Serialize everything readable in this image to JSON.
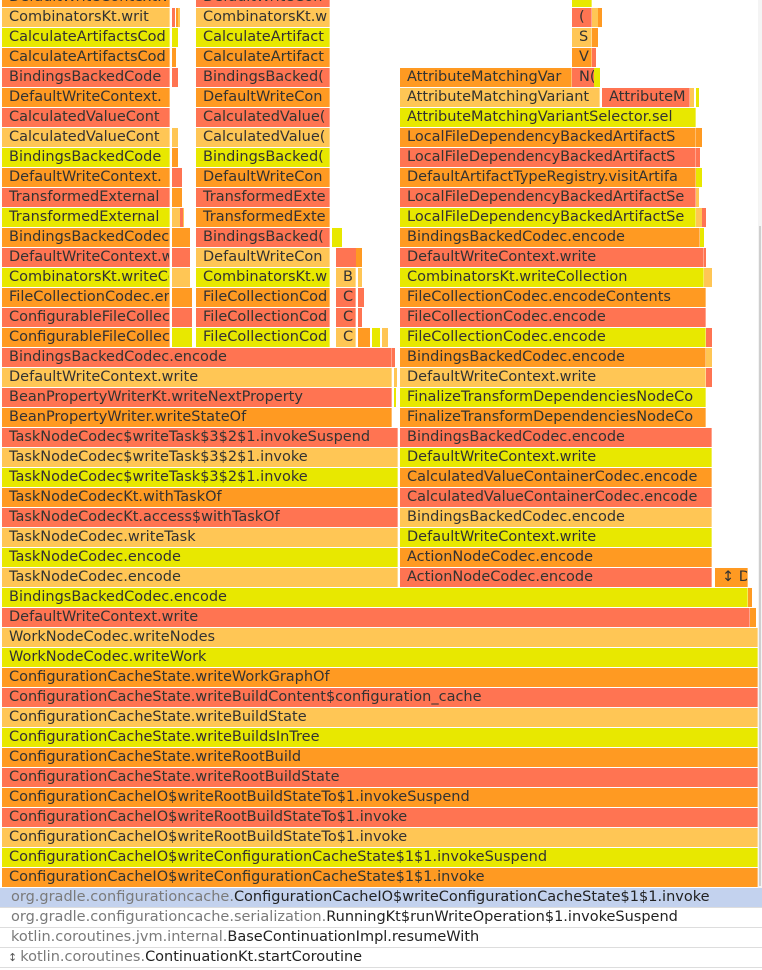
{
  "flame_graph": {
    "frames": [
      {
        "label": "DefaultWriteContext.write",
        "row": 0,
        "col": "L",
        "color": "orange"
      },
      {
        "label": "CombinatorsKt.writ",
        "row": 1,
        "col": "L",
        "color": "light"
      },
      {
        "label": "CalculateArtifactsCod",
        "row": 2,
        "col": "L",
        "color": "yellow"
      },
      {
        "label": "CalculateArtifactsCod",
        "row": 3,
        "col": "L",
        "color": "orange"
      },
      {
        "label": "BindingsBackedCode",
        "row": 4,
        "col": "L",
        "color": "red"
      },
      {
        "label": "DefaultWriteContext.",
        "row": 5,
        "col": "L",
        "color": "orange"
      },
      {
        "label": "CalculatedValueCont",
        "row": 6,
        "col": "L",
        "color": "red"
      },
      {
        "label": "CalculatedValueCont",
        "row": 7,
        "col": "L",
        "color": "light"
      },
      {
        "label": "BindingsBackedCode",
        "row": 8,
        "col": "L",
        "color": "yellow"
      },
      {
        "label": "DefaultWriteContext.",
        "row": 9,
        "col": "L",
        "color": "orange"
      },
      {
        "label": "TransformedExternal",
        "row": 10,
        "col": "L",
        "color": "red"
      },
      {
        "label": "TransformedExternal",
        "row": 11,
        "col": "L",
        "color": "yellow"
      },
      {
        "label": "BindingsBackedCodec.",
        "row": 12,
        "col": "L",
        "color": "orange"
      },
      {
        "label": "DefaultWriteContext.wi",
        "row": 13,
        "col": "L",
        "color": "red"
      },
      {
        "label": "CombinatorsKt.writeCo",
        "row": 14,
        "col": "L",
        "color": "yellow"
      },
      {
        "label": "FileCollectionCodec.enc",
        "row": 15,
        "col": "L",
        "color": "orange"
      },
      {
        "label": "ConfigurableFileCollecti",
        "row": 16,
        "col": "L",
        "color": "red"
      },
      {
        "label": "ConfigurableFileCollecti",
        "row": 17,
        "col": "L",
        "color": "orange"
      },
      {
        "label": "DefaultWriteCon",
        "row": 0,
        "col": "M",
        "color": "red"
      },
      {
        "label": "CombinatorsKt.w",
        "row": 1,
        "col": "M",
        "color": "light"
      },
      {
        "label": "CalculateArtifact",
        "row": 2,
        "col": "M",
        "color": "yellow"
      },
      {
        "label": "CalculateArtifact",
        "row": 3,
        "col": "M",
        "color": "orange"
      },
      {
        "label": "BindingsBacked(",
        "row": 4,
        "col": "M",
        "color": "red"
      },
      {
        "label": "DefaultWriteCon",
        "row": 5,
        "col": "M",
        "color": "orange"
      },
      {
        "label": "CalculatedValue(",
        "row": 6,
        "col": "M",
        "color": "red"
      },
      {
        "label": "CalculatedValue(",
        "row": 7,
        "col": "M",
        "color": "light"
      },
      {
        "label": "BindingsBacked(",
        "row": 8,
        "col": "M",
        "color": "yellow"
      },
      {
        "label": "DefaultWriteCon",
        "row": 9,
        "col": "M",
        "color": "orange"
      },
      {
        "label": "TransformedExte",
        "row": 10,
        "col": "M",
        "color": "red"
      },
      {
        "label": "TransformedExte",
        "row": 11,
        "col": "M",
        "color": "orange"
      },
      {
        "label": "BindingsBacked(",
        "row": 12,
        "col": "M",
        "color": "red"
      },
      {
        "label": "DefaultWriteCon",
        "row": 13,
        "col": "M",
        "color": "light"
      },
      {
        "label": "CombinatorsKt.w",
        "row": 14,
        "col": "M",
        "color": "yellow"
      },
      {
        "label": "FileCollectionCod",
        "row": 15,
        "col": "M",
        "color": "orange"
      },
      {
        "label": "FileCollectionCod",
        "row": 16,
        "col": "M",
        "color": "red"
      },
      {
        "label": "FileCollectionCod",
        "row": 17,
        "col": "M",
        "color": "yellow"
      },
      {
        "label": "B",
        "row": 14,
        "col": "S",
        "color": "light"
      },
      {
        "label": "C",
        "row": 15,
        "col": "S",
        "color": "red"
      },
      {
        "label": "C",
        "row": 16,
        "col": "S",
        "color": "red"
      },
      {
        "label": "C",
        "row": 17,
        "col": "S",
        "color": "light"
      },
      {
        "label": "",
        "row": 0,
        "col": "T",
        "color": "yellow"
      },
      {
        "label": "(",
        "row": 1,
        "col": "T",
        "color": "red"
      },
      {
        "label": "S",
        "row": 2,
        "col": "T",
        "color": "light"
      },
      {
        "label": "V",
        "row": 3,
        "col": "T",
        "color": "orange"
      },
      {
        "label": "N(",
        "row": 4,
        "col": "T2",
        "color": "red"
      },
      {
        "label": "AttributeMatchingVar",
        "row": 4,
        "col": "R1",
        "color": "orange"
      },
      {
        "label": "AttributeMatchingVariant",
        "row": 5,
        "col": "R2",
        "color": "light"
      },
      {
        "label": "AttributeM",
        "row": 5,
        "col": "R3",
        "color": "red"
      },
      {
        "label": "AttributeMatchingVariantSelector.sel",
        "row": 6,
        "col": "R",
        "color": "yellow"
      },
      {
        "label": "LocalFileDependencyBackedArtifactS",
        "row": 7,
        "col": "R",
        "color": "orange"
      },
      {
        "label": "LocalFileDependencyBackedArtifactS",
        "row": 8,
        "col": "R",
        "color": "red"
      },
      {
        "label": "DefaultArtifactTypeRegistry.visitArtifa",
        "row": 9,
        "col": "R",
        "color": "orange"
      },
      {
        "label": "LocalFileDependencyBackedArtifactSe",
        "row": 10,
        "col": "R",
        "color": "red"
      },
      {
        "label": "LocalFileDependencyBackedArtifactSe",
        "row": 11,
        "col": "R",
        "color": "yellow"
      },
      {
        "label": "BindingsBackedCodec.encode",
        "row": 12,
        "col": "R",
        "color": "orange"
      },
      {
        "label": "DefaultWriteContext.write",
        "row": 13,
        "col": "R",
        "color": "red"
      },
      {
        "label": "CombinatorsKt.writeCollection",
        "row": 14,
        "col": "R",
        "color": "yellow"
      },
      {
        "label": "FileCollectionCodec.encodeContents",
        "row": 15,
        "col": "R",
        "color": "orange"
      },
      {
        "label": "FileCollectionCodec.encode",
        "row": 16,
        "col": "R",
        "color": "red"
      },
      {
        "label": "FileCollectionCodec.encode",
        "row": 17,
        "col": "R",
        "color": "yellow"
      },
      {
        "label": "BindingsBackedCodec.encode",
        "row": 18,
        "col": "R",
        "color": "orange"
      },
      {
        "label": "DefaultWriteContext.write",
        "row": 19,
        "col": "R",
        "color": "light"
      },
      {
        "label": "FinalizeTransformDependenciesNodeCo",
        "row": 20,
        "col": "R",
        "color": "yellow"
      },
      {
        "label": "FinalizeTransformDependenciesNodeCo",
        "row": 21,
        "col": "R",
        "color": "orange"
      },
      {
        "label": "BindingsBackedCodec.encode",
        "row": 22,
        "col": "R",
        "color": "red"
      },
      {
        "label": "DefaultWriteContext.write",
        "row": 23,
        "col": "R",
        "color": "yellow"
      },
      {
        "label": "CalculatedValueContainerCodec.encode",
        "row": 24,
        "col": "R",
        "color": "orange"
      },
      {
        "label": "CalculatedValueContainerCodec.encode",
        "row": 25,
        "col": "R",
        "color": "red"
      },
      {
        "label": "BindingsBackedCodec.encode",
        "row": 26,
        "col": "R",
        "color": "light"
      },
      {
        "label": "DefaultWriteContext.write",
        "row": 27,
        "col": "R",
        "color": "yellow"
      },
      {
        "label": "ActionNodeCodec.encode",
        "row": 28,
        "col": "R",
        "color": "orange"
      },
      {
        "label": "ActionNodeCodec.encode",
        "row": 29,
        "col": "R",
        "color": "red"
      },
      {
        "label": "↕ D",
        "row": 29,
        "col": "X",
        "color": "orange"
      },
      {
        "label": "BindingsBackedCodec.encode",
        "row": 18,
        "col": "LW",
        "color": "red"
      },
      {
        "label": "DefaultWriteContext.write",
        "row": 19,
        "col": "LW",
        "color": "light"
      },
      {
        "label": "BeanPropertyWriterKt.writeNextProperty",
        "row": 20,
        "col": "LW",
        "color": "red"
      },
      {
        "label": "BeanPropertyWriter.writeStateOf",
        "row": 21,
        "col": "LW",
        "color": "orange"
      },
      {
        "label": "TaskNodeCodec$writeTask$3$2$1.invokeSuspend",
        "row": 22,
        "col": "LX",
        "color": "red"
      },
      {
        "label": "TaskNodeCodec$writeTask$3$2$1.invoke",
        "row": 23,
        "col": "LX",
        "color": "light"
      },
      {
        "label": "TaskNodeCodec$writeTask$3$2$1.invoke",
        "row": 24,
        "col": "LX",
        "color": "yellow"
      },
      {
        "label": "TaskNodeCodecKt.withTaskOf",
        "row": 25,
        "col": "LX",
        "color": "orange"
      },
      {
        "label": "TaskNodeCodecKt.access$withTaskOf",
        "row": 26,
        "col": "LX",
        "color": "red"
      },
      {
        "label": "TaskNodeCodec.writeTask",
        "row": 27,
        "col": "LX",
        "color": "light"
      },
      {
        "label": "TaskNodeCodec.encode",
        "row": 28,
        "col": "LX",
        "color": "yellow"
      },
      {
        "label": "TaskNodeCodec.encode",
        "row": 29,
        "col": "LX",
        "color": "light"
      },
      {
        "label": "BindingsBackedCodec.encode",
        "row": 30,
        "col": "F1",
        "color": "yellow"
      },
      {
        "label": "DefaultWriteContext.write",
        "row": 31,
        "col": "F2",
        "color": "red"
      },
      {
        "label": "WorkNodeCodec.writeNodes",
        "row": 32,
        "col": "F",
        "color": "light"
      },
      {
        "label": "WorkNodeCodec.writeWork",
        "row": 33,
        "col": "F",
        "color": "yellow"
      },
      {
        "label": "ConfigurationCacheState.writeWorkGraphOf",
        "row": 34,
        "col": "F",
        "color": "orange"
      },
      {
        "label": "ConfigurationCacheState.writeBuildContent$configuration_cache",
        "row": 35,
        "col": "F",
        "color": "red"
      },
      {
        "label": "ConfigurationCacheState.writeBuildState",
        "row": 36,
        "col": "F",
        "color": "light"
      },
      {
        "label": "ConfigurationCacheState.writeBuildsInTree",
        "row": 37,
        "col": "F",
        "color": "yellow"
      },
      {
        "label": "ConfigurationCacheState.writeRootBuild",
        "row": 38,
        "col": "F",
        "color": "orange"
      },
      {
        "label": "ConfigurationCacheState.writeRootBuildState",
        "row": 39,
        "col": "F",
        "color": "red"
      },
      {
        "label": "ConfigurationCacheIO$writeRootBuildStateTo$1.invokeSuspend",
        "row": 40,
        "col": "F",
        "color": "orange"
      },
      {
        "label": "ConfigurationCacheIO$writeRootBuildStateTo$1.invoke",
        "row": 41,
        "col": "F",
        "color": "red"
      },
      {
        "label": "ConfigurationCacheIO$writeRootBuildStateTo$1.invoke",
        "row": 42,
        "col": "F",
        "color": "light"
      },
      {
        "label": "ConfigurationCacheIO$writeConfigurationCacheState$1$1.invokeSuspend",
        "row": 43,
        "col": "F",
        "color": "yellow"
      },
      {
        "label": "ConfigurationCacheIO$writeConfigurationCacheState$1$1.invoke",
        "row": 44,
        "col": "F",
        "color": "orange"
      }
    ]
  },
  "call_stack": {
    "rows": [
      {
        "package": "org.gradle.configurationcache.",
        "method": "ConfigurationCacheIO$writeConfigurationCacheState$1$1.invoke",
        "selected": true,
        "sort_glyph": ""
      },
      {
        "package": "org.gradle.configurationcache.serialization.",
        "method": "RunningKt$runWriteOperation$1.invokeSuspend",
        "selected": false,
        "sort_glyph": ""
      },
      {
        "package": "kotlin.coroutines.jvm.internal.",
        "method": "BaseContinuationImpl.resumeWith",
        "selected": false,
        "sort_glyph": ""
      },
      {
        "package": "kotlin.coroutines.",
        "method": "ContinuationKt.startCoroutine",
        "selected": false,
        "sort_glyph": "↕"
      }
    ]
  },
  "colors": {
    "red": "#ff7452",
    "orange": "#ff9a22",
    "light": "#ffc655",
    "yellow": "#e8e800",
    "selected_row": "#c3d2ee"
  }
}
